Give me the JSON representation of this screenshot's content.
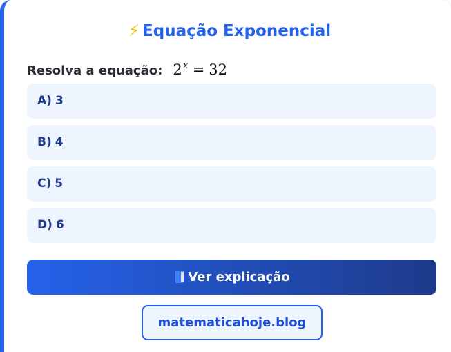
{
  "quiz": {
    "title_icon": "lightning-icon",
    "title": "Equação Exponencial",
    "question_label": "Resolva a equação:",
    "equation": {
      "base": "2",
      "exponent": "x",
      "equals": "=",
      "result": "32"
    },
    "options": [
      {
        "letter": "A)",
        "value": "3"
      },
      {
        "letter": "B)",
        "value": "4"
      },
      {
        "letter": "C)",
        "value": "5"
      },
      {
        "letter": "D)",
        "value": "6"
      }
    ],
    "explain_icon": "book-icon",
    "explain_label": "Ver explicação",
    "site_label": "matematicahoje.blog"
  },
  "colors": {
    "accent": "#2563eb",
    "accent_dark": "#1e3a8a",
    "option_bg": "#eff5fe",
    "bolt": "#f5b400"
  }
}
